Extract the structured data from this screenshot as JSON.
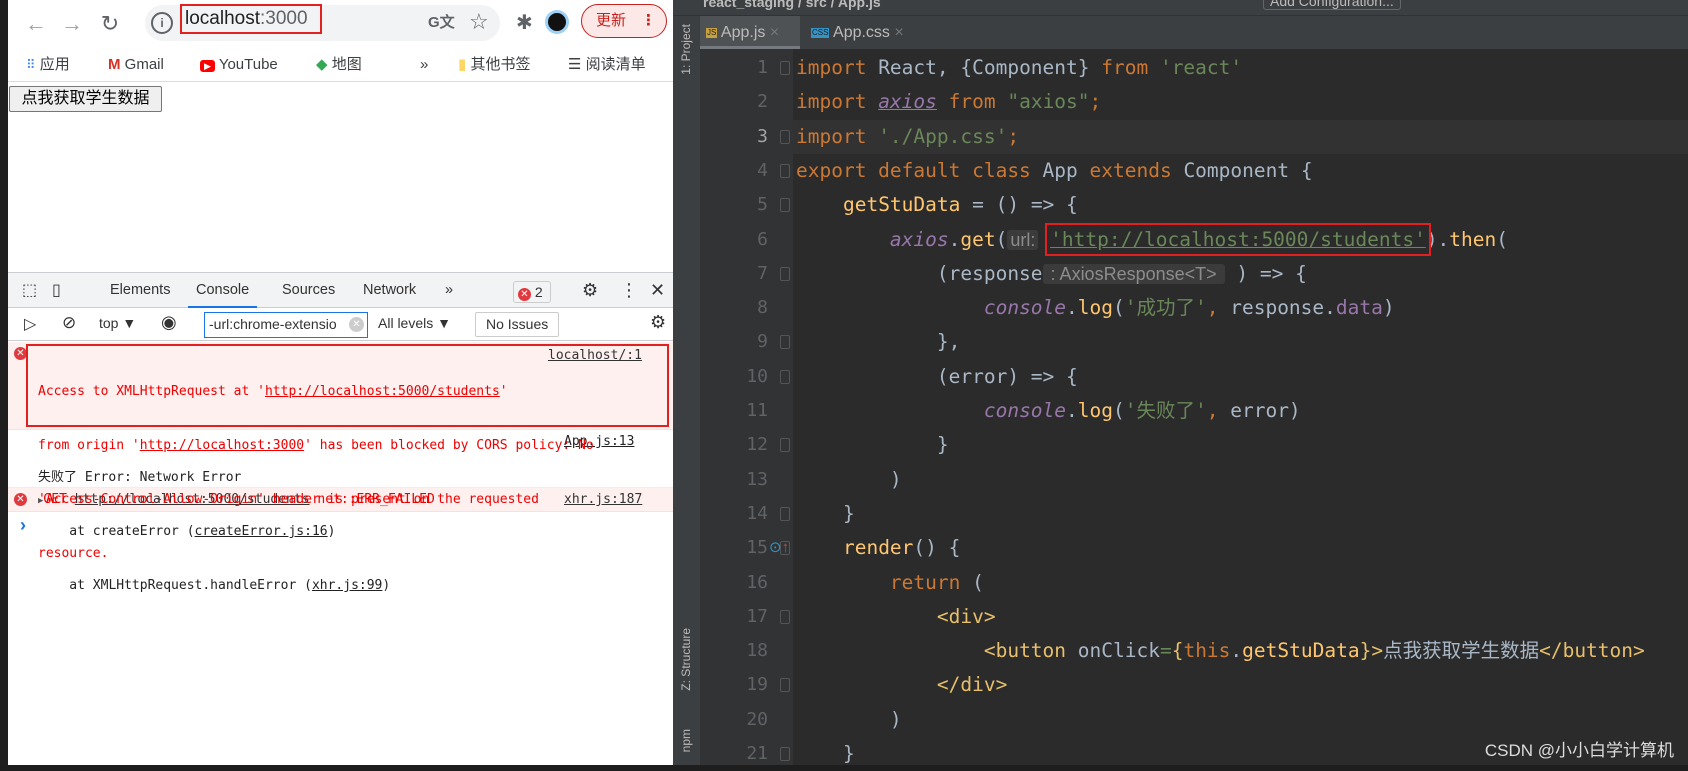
{
  "browser": {
    "url_host": "localhost",
    "url_port": ":3000",
    "update_label": "更新",
    "bookmarks": [
      "应用",
      "Gmail",
      "YouTube",
      "地图",
      "»",
      "其他书签",
      "阅读清单"
    ],
    "page_button": "点我获取学生数据"
  },
  "devtools": {
    "tabs": [
      "Elements",
      "Console",
      "Sources",
      "Network",
      "»"
    ],
    "active_tab": "Console",
    "error_count": "2",
    "context": "top ▼",
    "filter_value": "-url:chrome-extensio",
    "levels": "All levels ▼",
    "issues": "No Issues",
    "messages": {
      "cors": {
        "l1a": "Access to XMLHttpRequest at '",
        "l1url": "http://localhost:5000/students",
        "l1b": "'",
        "source": "localhost/:1",
        "l2a": "from origin '",
        "l2url": "http://localhost:3000",
        "l2b": "' has been blocked by CORS policy: No",
        "l3": "'Access-Control-Allow-Origin' header is present on the requested",
        "l4": "resource."
      },
      "log": {
        "prefix": "失败了",
        "text": " Error: Network Error",
        "source": "App.js:13",
        "s1a": "    at createError (",
        "s1link": "createError.js:16",
        "s1b": ")",
        "s2a": "    at XMLHttpRequest.handleError (",
        "s2link": "xhr.js:99",
        "s2b": ")"
      },
      "get": {
        "method": "GET",
        "url": "http://localhost:5000/students",
        "status": "net::ERR_FAILED",
        "source": "xhr.js:187"
      }
    },
    "prompt": "›"
  },
  "ide": {
    "breadcrumb": "react_staging / src / App.js",
    "config_button": "Add Configuration...",
    "side_tabs": [
      "1: Project",
      "Z: Structure",
      "npm"
    ],
    "tabs": [
      {
        "label": "App.js",
        "type": "JS"
      },
      {
        "label": "App.css",
        "type": "CSS"
      }
    ],
    "code": [
      [
        [
          "import ",
          "kw"
        ],
        [
          "React, {Component} ",
          "df"
        ],
        [
          "from ",
          "kw"
        ],
        [
          "'react'",
          "str"
        ]
      ],
      [
        [
          "import ",
          "kw"
        ],
        [
          "axios",
          "pur it ul"
        ],
        [
          " ",
          "df"
        ],
        [
          "from ",
          "kw"
        ],
        [
          "\"axios\"",
          "str"
        ],
        [
          ";",
          "kw"
        ]
      ],
      [
        [
          "import ",
          "kw"
        ],
        [
          "'./App.css'",
          "str"
        ],
        [
          ";",
          "kw"
        ]
      ],
      [
        [
          "export default class ",
          "kw"
        ],
        [
          "App ",
          "df"
        ],
        [
          "extends ",
          "kw"
        ],
        [
          "Component {",
          "df"
        ]
      ],
      [
        [
          "    ",
          "df"
        ],
        [
          "getStuData",
          "fn"
        ],
        [
          " = () => {",
          "df"
        ]
      ],
      [
        [
          "        ",
          "df"
        ],
        [
          "axios",
          "pur it"
        ],
        [
          ".",
          "df"
        ],
        [
          "get",
          "fn"
        ],
        [
          "(",
          "df"
        ],
        [
          "url:",
          "hint"
        ],
        [
          " ",
          "df"
        ],
        [
          "'http://localhost:5000/students'",
          "str ul boxed"
        ],
        [
          ").",
          "df"
        ],
        [
          "then",
          "fn"
        ],
        [
          "(",
          "df"
        ]
      ],
      [
        [
          "            (response",
          "df"
        ],
        [
          " : AxiosResponse<T> ",
          "hint"
        ],
        [
          " ) => {",
          "df"
        ]
      ],
      [
        [
          "                ",
          "df"
        ],
        [
          "console",
          "pur it"
        ],
        [
          ".",
          "df"
        ],
        [
          "log",
          "fn"
        ],
        [
          "(",
          "df"
        ],
        [
          "'成功了'",
          "str"
        ],
        [
          ", ",
          "kw"
        ],
        [
          "response.",
          "df"
        ],
        [
          "data",
          "pur"
        ],
        [
          ")",
          "df"
        ]
      ],
      [
        [
          "            },",
          "df"
        ]
      ],
      [
        [
          "            (error) => {",
          "df"
        ]
      ],
      [
        [
          "                ",
          "df"
        ],
        [
          "console",
          "pur it"
        ],
        [
          ".",
          "df"
        ],
        [
          "log",
          "fn"
        ],
        [
          "(",
          "df"
        ],
        [
          "'失败了'",
          "str"
        ],
        [
          ", ",
          "kw"
        ],
        [
          "error)",
          "df"
        ]
      ],
      [
        [
          "            }",
          "df"
        ]
      ],
      [
        [
          "        )",
          "df"
        ]
      ],
      [
        [
          "    }",
          "df"
        ]
      ],
      [
        [
          "    ",
          "df"
        ],
        [
          "render",
          "fn"
        ],
        [
          "() {",
          "df"
        ]
      ],
      [
        [
          "        ",
          "df"
        ],
        [
          "return ",
          "kw"
        ],
        [
          "(",
          "df"
        ]
      ],
      [
        [
          "            ",
          "df"
        ],
        [
          "<div>",
          "tag"
        ]
      ],
      [
        [
          "                ",
          "df"
        ],
        [
          "<button ",
          "tag"
        ],
        [
          "onClick",
          "df"
        ],
        [
          "=",
          "str"
        ],
        [
          "{",
          "tag"
        ],
        [
          "this",
          "kw"
        ],
        [
          ".",
          "df"
        ],
        [
          "getStuData",
          "fn"
        ],
        [
          "}",
          "tag"
        ],
        [
          ">",
          "tag"
        ],
        [
          "点我获取学生数据",
          "df"
        ],
        [
          "</button>",
          "tag"
        ]
      ],
      [
        [
          "            ",
          "df"
        ],
        [
          "</div>",
          "tag"
        ]
      ],
      [
        [
          "        )",
          "df"
        ]
      ],
      [
        [
          "    }",
          "df"
        ]
      ]
    ],
    "watermark": "CSDN @小小白学计算机"
  },
  "colors": {
    "keyword": "#cc7832",
    "string": "#6a8759",
    "function": "#ffc66d",
    "field": "#9876aa",
    "highlight": "#e32020"
  }
}
